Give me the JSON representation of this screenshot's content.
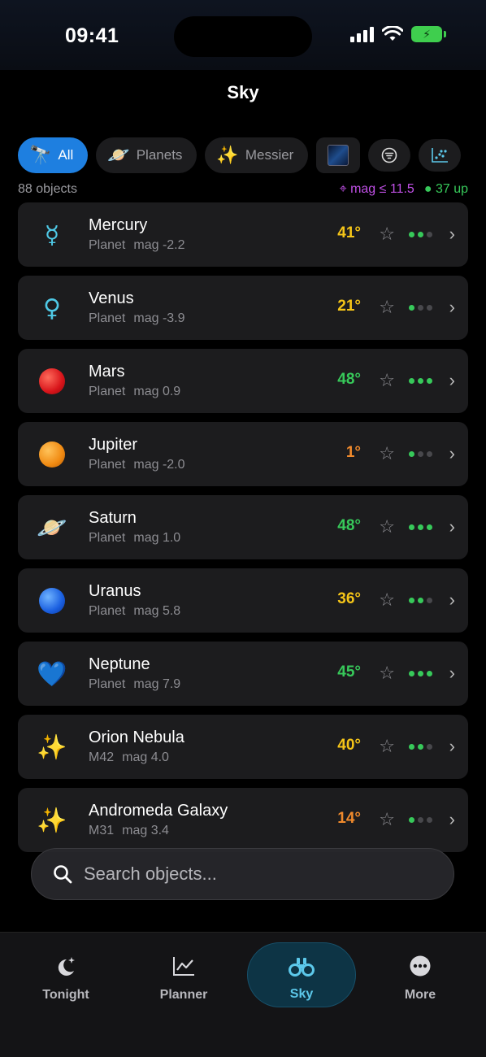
{
  "status": {
    "time": "09:41"
  },
  "header": {
    "title": "Sky"
  },
  "filters": {
    "all": "All",
    "planets": "Planets",
    "messier": "Messier"
  },
  "summary": {
    "count": "88 objects",
    "mag_filter": "⌖ mag ≤ 11.5",
    "up_count": "● 37 up"
  },
  "objects": [
    {
      "name": "Mercury",
      "type": "Planet",
      "mag": "mag -2.2",
      "alt": "41°",
      "alt_color": "#f5c518",
      "dots": 2,
      "icon": "mercury-symbol"
    },
    {
      "name": "Venus",
      "type": "Planet",
      "mag": "mag -3.9",
      "alt": "21°",
      "alt_color": "#f5c518",
      "dots": 1,
      "icon": "venus-symbol"
    },
    {
      "name": "Mars",
      "type": "Planet",
      "mag": "mag 0.9",
      "alt": "48°",
      "alt_color": "#37c95a",
      "dots": 3,
      "icon": "red-circle"
    },
    {
      "name": "Jupiter",
      "type": "Planet",
      "mag": "mag -2.0",
      "alt": "1°",
      "alt_color": "#f08a2c",
      "dots": 1,
      "icon": "orange-circle"
    },
    {
      "name": "Saturn",
      "type": "Planet",
      "mag": "mag 1.0",
      "alt": "48°",
      "alt_color": "#37c95a",
      "dots": 3,
      "icon": "ringed-planet"
    },
    {
      "name": "Uranus",
      "type": "Planet",
      "mag": "mag 5.8",
      "alt": "36°",
      "alt_color": "#f5c518",
      "dots": 2,
      "icon": "blue-circle"
    },
    {
      "name": "Neptune",
      "type": "Planet",
      "mag": "mag 7.9",
      "alt": "45°",
      "alt_color": "#37c95a",
      "dots": 3,
      "icon": "blue-heart"
    },
    {
      "name": "Orion Nebula",
      "type": "M42",
      "mag": "mag 4.0",
      "alt": "40°",
      "alt_color": "#f5c518",
      "dots": 2,
      "icon": "sparkles"
    },
    {
      "name": "Andromeda Galaxy",
      "type": "M31",
      "mag": "mag 3.4",
      "alt": "14°",
      "alt_color": "#f08a2c",
      "dots": 1,
      "icon": "sparkles"
    }
  ],
  "search": {
    "placeholder": "Search objects..."
  },
  "tabs": {
    "tonight": "Tonight",
    "planner": "Planner",
    "sky": "Sky",
    "more": "More"
  }
}
